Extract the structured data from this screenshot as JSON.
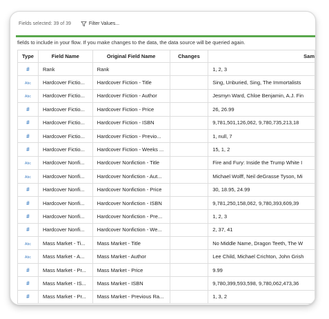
{
  "toolbar": {
    "fields_selected": "Fields selected: 39 of 39",
    "filter_values": "Filter Values...",
    "filter_icon": "funnel-icon"
  },
  "info_text": "fields to include in your flow. If you make changes to the data, the data source will be queried again.",
  "colors": {
    "accent": "#5aa84d",
    "type_icon": "#3a7cc2"
  },
  "table": {
    "headers": {
      "type": "Type",
      "field": "Field Name",
      "original": "Original Field Name",
      "changes": "Changes",
      "sample": "Sam"
    },
    "rows": [
      {
        "type": "#",
        "field": "Rank",
        "original": "Rank",
        "changes": "",
        "sample": "1, 2, 3"
      },
      {
        "type": "Abc",
        "field": "Hardcover Fictio...",
        "original": "Hardcover Fiction - Title",
        "changes": "",
        "sample": "Sing, Unburied, Sing, The Immortalists"
      },
      {
        "type": "Abc",
        "field": "Hardcover Fictio...",
        "original": "Hardcover Fiction - Author",
        "changes": "",
        "sample": "Jesmyn Ward, Chloe Benjamin, A.J. Fin"
      },
      {
        "type": "#",
        "field": "Hardcover Fictio...",
        "original": "Hardcover Fiction - Price",
        "changes": "",
        "sample": "26, 26.99"
      },
      {
        "type": "#",
        "field": "Hardcover Fictio...",
        "original": "Hardcover Fiction - ISBN",
        "changes": "",
        "sample": "9,781,501,126,062, 9,780,735,213,18"
      },
      {
        "type": "#",
        "field": "Hardcover Fictio...",
        "original": "Hardcover Fiction - Previo...",
        "changes": "",
        "sample": "1, null, 7"
      },
      {
        "type": "#",
        "field": "Hardcover Fictio...",
        "original": "Hardcover Fiction - Weeks ...",
        "changes": "",
        "sample": "15, 1, 2"
      },
      {
        "type": "Abc",
        "field": "Hardcover Nonfi...",
        "original": "Hardcover Nonfiction - Title",
        "changes": "",
        "sample": "Fire and Fury: Inside the Trump White I"
      },
      {
        "type": "Abc",
        "field": "Hardcover Nonfi...",
        "original": "Hardcover Nonfiction - Aut...",
        "changes": "",
        "sample": "Michael Wolff, Neil deGrasse Tyson, Mi"
      },
      {
        "type": "#",
        "field": "Hardcover Nonfi...",
        "original": "Hardcover Nonfiction - Price",
        "changes": "",
        "sample": "30, 18.95, 24.99"
      },
      {
        "type": "#",
        "field": "Hardcover Nonfi...",
        "original": "Hardcover Nonfiction - ISBN",
        "changes": "",
        "sample": "9,781,250,158,062, 9,780,393,609,39"
      },
      {
        "type": "#",
        "field": "Hardcover Nonfi...",
        "original": "Hardcover Nonfiction - Pre...",
        "changes": "",
        "sample": "1, 2, 3"
      },
      {
        "type": "#",
        "field": "Hardcover Nonfi...",
        "original": "Hardcover Nonfiction - We...",
        "changes": "",
        "sample": "2, 37, 41"
      },
      {
        "type": "Abc",
        "field": "Mass Market - Ti...",
        "original": "Mass Market - Title",
        "changes": "",
        "sample": "No Middle Name, Dragon Teeth, The W"
      },
      {
        "type": "Abc",
        "field": "Mass Market - A...",
        "original": "Mass Market - Author",
        "changes": "",
        "sample": "Lee Child, Michael Crichton, John Grish"
      },
      {
        "type": "#",
        "field": "Mass Market - Pr...",
        "original": "Mass Market - Price",
        "changes": "",
        "sample": "9.99"
      },
      {
        "type": "#",
        "field": "Mass Market - IS...",
        "original": "Mass Market - ISBN",
        "changes": "",
        "sample": "9,780,399,593,598, 9,780,062,473,36"
      },
      {
        "type": "#",
        "field": "Mass Market - Pr...",
        "original": "Mass Market - Previous Ra...",
        "changes": "",
        "sample": "1, 3, 2"
      }
    ]
  }
}
